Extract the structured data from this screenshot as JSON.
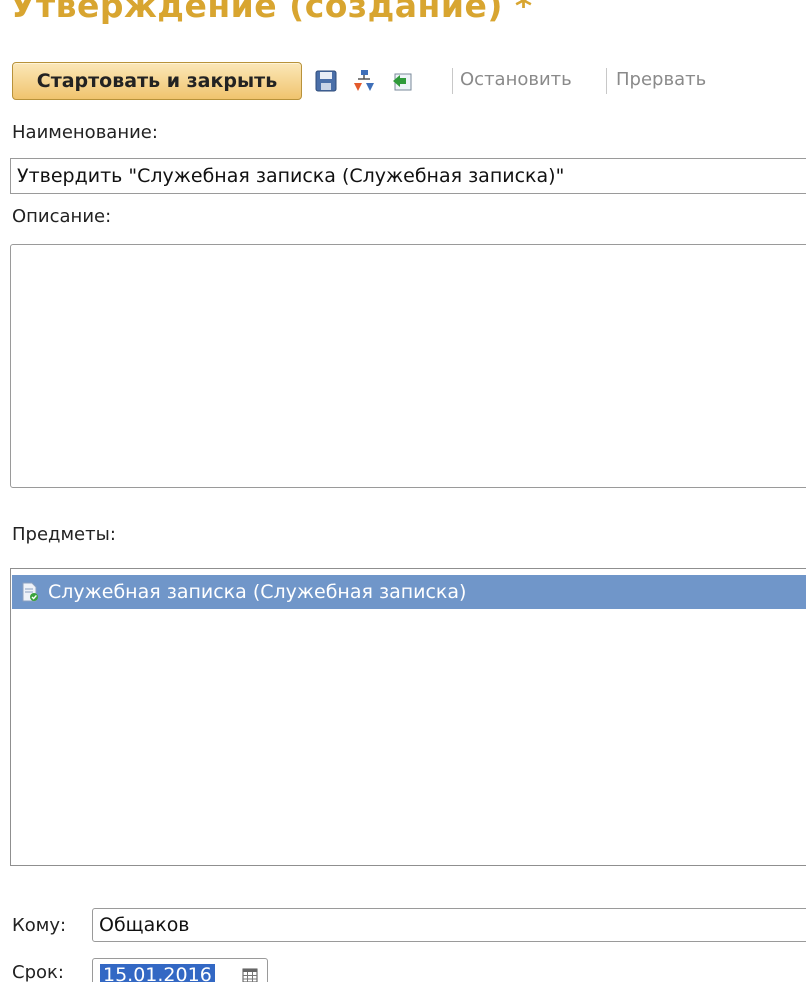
{
  "window": {
    "title": "Утверждение (создание) *"
  },
  "toolbar": {
    "start_close_label": "Стартовать и закрыть",
    "save_icon": "save-icon",
    "route_icon": "route-icon",
    "back_icon": "back-icon",
    "stop_label": "Остановить",
    "abort_label": "Прервать"
  },
  "form": {
    "name_label": "Наименование:",
    "name_value": "Утвердить \"Служебная записка (Служебная записка)\"",
    "description_label": "Описание:",
    "description_value": "",
    "subjects_label": "Предметы:",
    "subjects": [
      {
        "icon": "document-approved-icon",
        "label": "Служебная записка (Служебная записка)",
        "selected": true
      }
    ],
    "to_label": "Кому:",
    "to_value": "Общаков",
    "due_label": "Срок:",
    "due_value": "15.01.2016"
  },
  "colors": {
    "title": "#d8a530",
    "selection": "#7096c9",
    "button_gradient_top": "#fbe7b8",
    "button_gradient_bottom": "#f0c46e"
  }
}
